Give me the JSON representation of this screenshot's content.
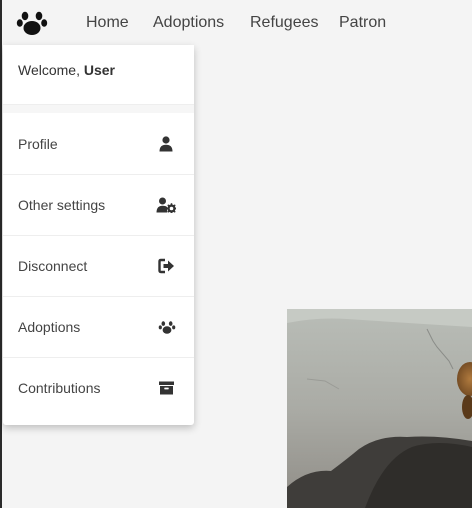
{
  "nav": {
    "brand_icon": "paw-icon",
    "links": [
      {
        "label": "Home"
      },
      {
        "label": "Adoptions"
      },
      {
        "label": "Refugees"
      },
      {
        "label": "Patron"
      }
    ]
  },
  "user_menu": {
    "welcome_prefix": "Welcome, ",
    "username": "User",
    "items": [
      {
        "label": "Profile",
        "icon": "user-icon"
      },
      {
        "label": "Other settings",
        "icon": "user-cog-icon"
      },
      {
        "label": "Disconnect",
        "icon": "sign-out-icon"
      },
      {
        "label": "Adoptions",
        "icon": "paw-icon"
      },
      {
        "label": "Contributions",
        "icon": "archive-icon"
      }
    ]
  },
  "colors": {
    "page_background": "#f4f4f4",
    "menu_background": "#ffffff",
    "text": "#444444",
    "icon": "#333333"
  }
}
